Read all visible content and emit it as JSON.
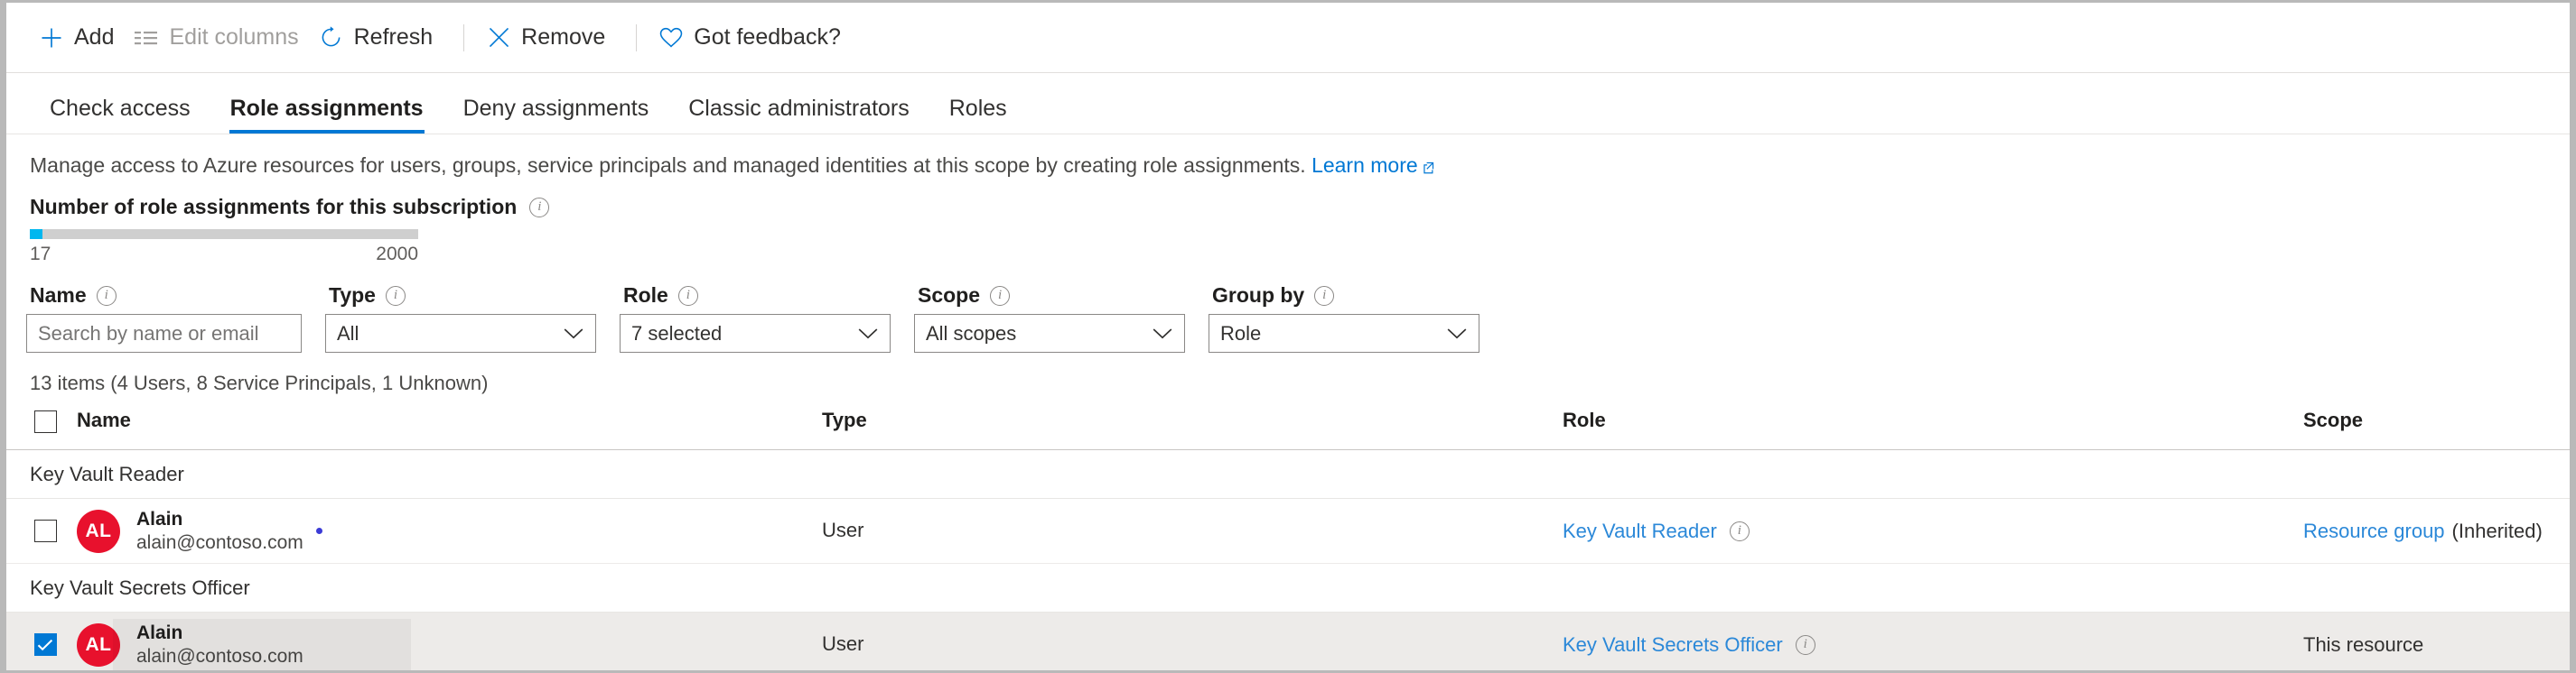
{
  "commandbar": {
    "buttons": [
      {
        "label": "Add",
        "icon": "plus-icon",
        "disabled": false,
        "sep_after": false
      },
      {
        "label": "Edit columns",
        "icon": "columns-icon",
        "disabled": true,
        "sep_after": false
      },
      {
        "label": "Refresh",
        "icon": "refresh-icon",
        "disabled": false,
        "sep_after": true
      },
      {
        "label": "Remove",
        "icon": "close-x-icon",
        "disabled": false,
        "sep_after": true
      },
      {
        "label": "Got feedback?",
        "icon": "heart-icon",
        "disabled": false,
        "sep_after": false
      }
    ],
    "accent_color": "#0078d4",
    "disabled_color": "#a19f9d"
  },
  "tabs": [
    {
      "label": "Check access",
      "active": false
    },
    {
      "label": "Role assignments",
      "active": true
    },
    {
      "label": "Deny assignments",
      "active": false
    },
    {
      "label": "Classic administrators",
      "active": false
    },
    {
      "label": "Roles",
      "active": false
    }
  ],
  "description": {
    "text": "Manage access to Azure resources for users, groups, service principals and managed identities at this scope by creating role assignments.",
    "link_label": "Learn more",
    "link_icon": "external-link-icon"
  },
  "quota": {
    "title": "Number of role assignments for this subscription",
    "info_icon": "info-icon",
    "current": "17",
    "max": "2000",
    "percent": 3.2,
    "fill_color": "#00b7ef",
    "track_color": "#cfcfcf"
  },
  "filters": [
    {
      "label": "Name",
      "info_icon": "info-icon",
      "control": "textbox",
      "value": "",
      "placeholder": "Search by name or email",
      "width_class": "w-name"
    },
    {
      "label": "Type",
      "info_icon": "info-icon",
      "control": "dropdown",
      "value": "All",
      "width_class": "w-type"
    },
    {
      "label": "Role",
      "info_icon": "info-icon",
      "control": "dropdown",
      "value": "7 selected",
      "width_class": "w-role"
    },
    {
      "label": "Scope",
      "info_icon": "info-icon",
      "control": "dropdown",
      "value": "All scopes",
      "width_class": "w-scope"
    },
    {
      "label": "Group by",
      "info_icon": "info-icon",
      "control": "dropdown",
      "value": "Role",
      "width_class": "w-group"
    }
  ],
  "results": {
    "count_text": "13 items (4 Users, 8 Service Principals, 1 Unknown)",
    "columns": {
      "name": "Name",
      "type": "Type",
      "role": "Role",
      "scope": "Scope"
    },
    "header_checkbox_checked": false,
    "groups": [
      {
        "group_label": "Key Vault Reader",
        "rows": [
          {
            "checked": false,
            "avatar_initials": "AL",
            "avatar_color": "#e8112d",
            "display_name": "Alain",
            "email": "alain@contoso.com",
            "has_dot_marker": true,
            "type": "User",
            "role": "Key Vault Reader",
            "role_info_icon": "info-icon",
            "scope_link": "Resource group",
            "scope_suffix": "(Inherited)",
            "scope_is_link": true,
            "highlighted": false
          }
        ]
      },
      {
        "group_label": "Key Vault Secrets Officer",
        "rows": [
          {
            "checked": true,
            "avatar_initials": "AL",
            "avatar_color": "#e8112d",
            "display_name": "Alain",
            "email": "alain@contoso.com",
            "has_dot_marker": false,
            "type": "User",
            "role": "Key Vault Secrets Officer",
            "role_info_icon": "info-icon",
            "scope_link": "This resource",
            "scope_suffix": "",
            "scope_is_link": false,
            "highlighted": true
          }
        ]
      }
    ]
  }
}
